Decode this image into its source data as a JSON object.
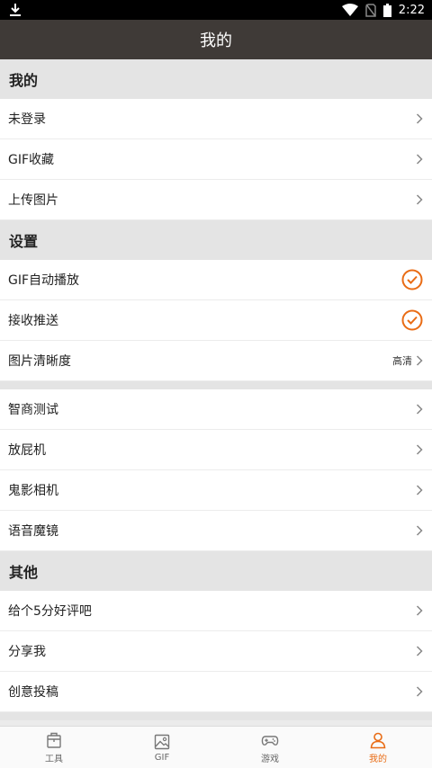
{
  "status_bar": {
    "time": "2:22"
  },
  "title": "我的",
  "sections": {
    "mine": {
      "header": "我的",
      "items": [
        {
          "label": "未登录"
        },
        {
          "label": "GIF收藏"
        },
        {
          "label": "上传图片"
        }
      ]
    },
    "settings": {
      "header": "设置",
      "items": [
        {
          "label": "GIF自动播放",
          "checked": true
        },
        {
          "label": "接收推送",
          "checked": true
        },
        {
          "label": "图片清晰度",
          "value": "高清"
        }
      ]
    },
    "tools": {
      "items": [
        {
          "label": "智商测试"
        },
        {
          "label": "放屁机"
        },
        {
          "label": "鬼影相机"
        },
        {
          "label": "语音魔镜"
        }
      ]
    },
    "other": {
      "header": "其他",
      "items": [
        {
          "label": "给个5分好评吧"
        },
        {
          "label": "分享我"
        },
        {
          "label": "创意投稿"
        }
      ]
    }
  },
  "tabs": [
    {
      "label": "工具",
      "icon": "toolbox-icon"
    },
    {
      "label": "GIF",
      "icon": "image-icon"
    },
    {
      "label": "游戏",
      "icon": "gamepad-icon"
    },
    {
      "label": "我的",
      "icon": "user-icon",
      "active": true
    }
  ],
  "colors": {
    "accent": "#e96c15",
    "title_bar": "#3f3a37",
    "section_bg": "#e4e4e4"
  }
}
